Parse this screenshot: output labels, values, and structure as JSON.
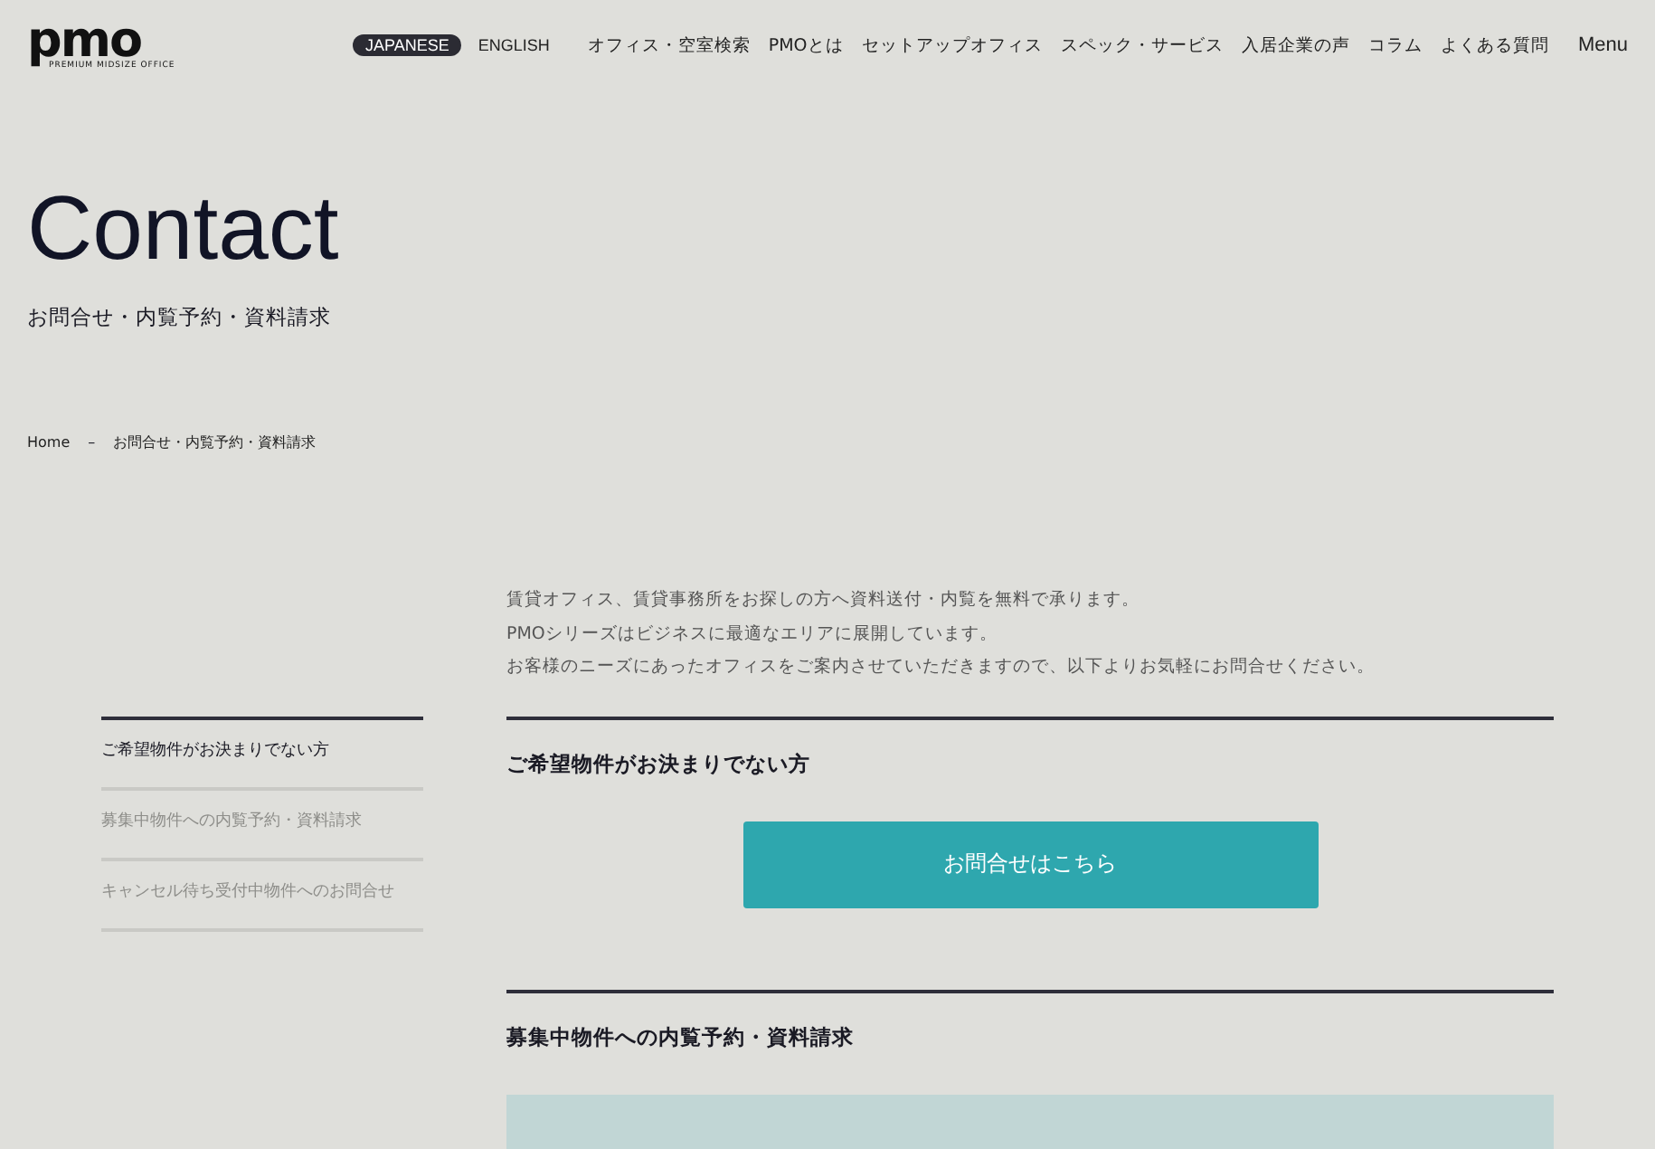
{
  "header": {
    "logo": {
      "mark": "pmo",
      "tagline": "PREMIUM MIDSIZE OFFICE"
    },
    "languages": [
      {
        "label": "JAPANESE",
        "selected": true
      },
      {
        "label": "ENGLISH",
        "selected": false
      }
    ],
    "nav": [
      "オフィス・空室検索",
      "PMOとは",
      "セットアップオフィス",
      "スペック・サービス",
      "入居企業の声",
      "コラム",
      "よくある質問"
    ],
    "menu": "Menu"
  },
  "hero": {
    "title": "Contact",
    "subtitle": "お問合せ・内覧予約・資料請求"
  },
  "breadcrumb": {
    "items": [
      "Home",
      "お問合せ・内覧予約・資料請求"
    ],
    "separator": "–"
  },
  "intro": [
    "賃貸オフィス、賃貸事務所をお探しの方へ資料送付・内覧を無料で承ります。",
    "PMOシリーズはビジネスに最適なエリアに展開しています。",
    "お客様のニーズにあったオフィスをご案内させていただきますので、以下よりお気軽にお問合せください。"
  ],
  "side_nav": [
    {
      "label": "ご希望物件がお決まりでない方",
      "selected": true
    },
    {
      "label": "募集中物件への内覧予約・資料請求",
      "selected": false
    },
    {
      "label": "キャンセル待ち受付中物件へのお問合せ",
      "selected": false
    }
  ],
  "sections": [
    {
      "kind": "button",
      "heading": "ご希望物件がお決まりでない方",
      "button": "お問合せはこちら"
    },
    {
      "kind": "panel",
      "heading": "募集中物件への内覧予約・資料請求"
    }
  ]
}
